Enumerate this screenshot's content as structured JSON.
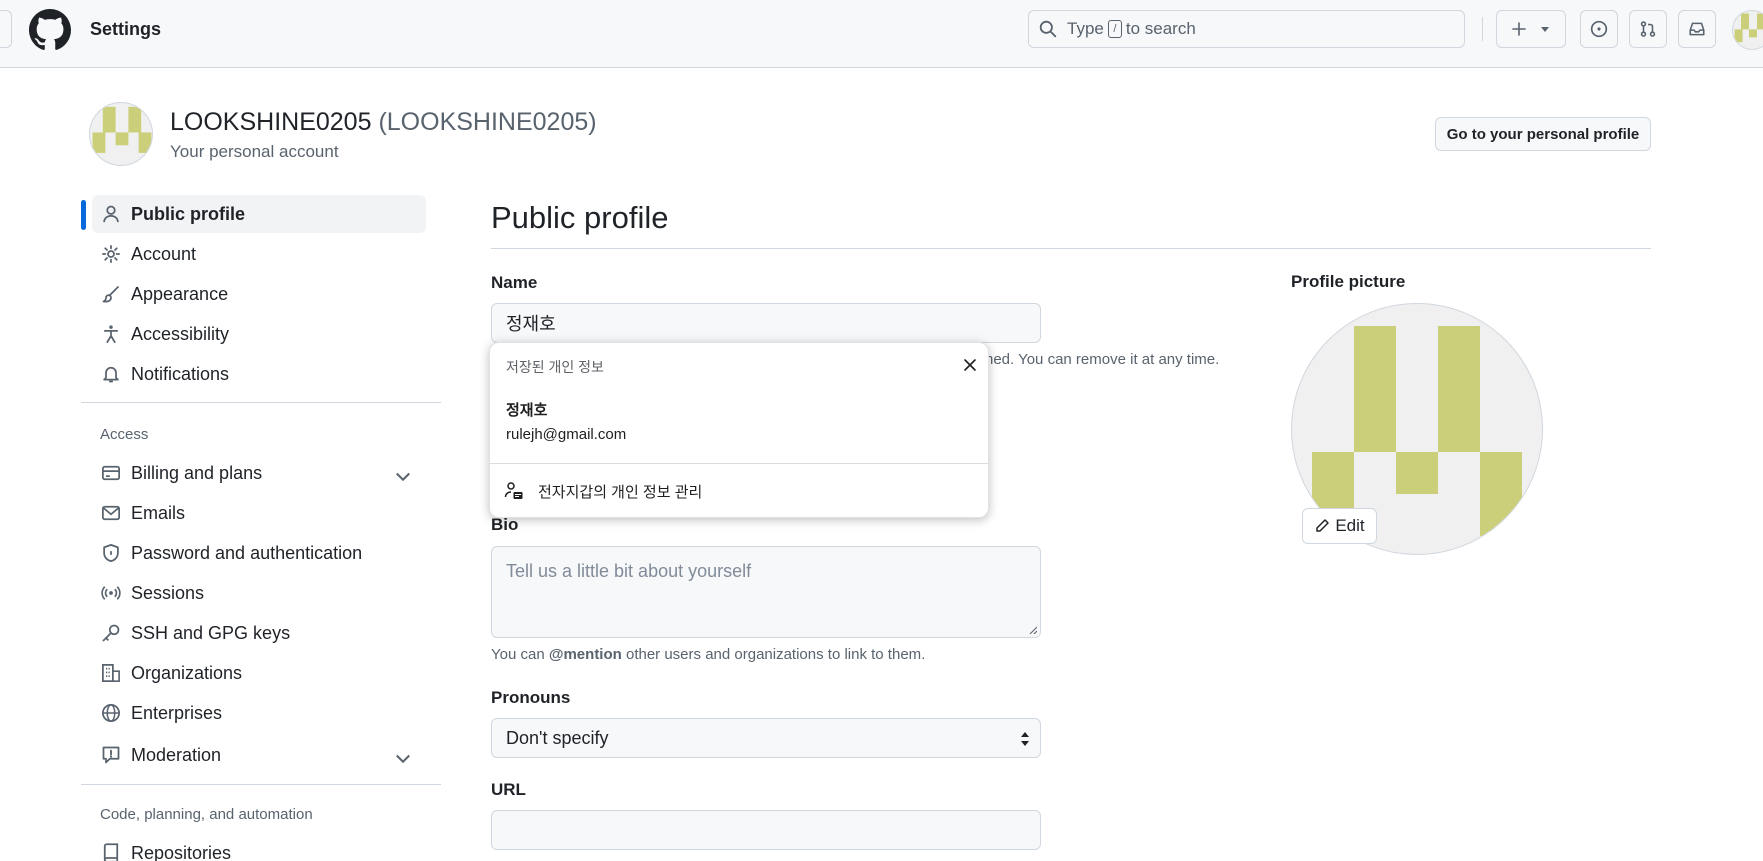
{
  "header": {
    "title": "Settings",
    "search": {
      "prefix": "Type",
      "key": "/",
      "suffix": "to search"
    }
  },
  "account": {
    "name": "LOOKSHINE0205",
    "login": "(LOOKSHINE0205)",
    "subtitle": "Your personal account",
    "profile_button": "Go to your personal profile"
  },
  "sidebar": {
    "items": [
      {
        "label": "Public profile",
        "icon": "person-icon"
      },
      {
        "label": "Account",
        "icon": "gear-icon"
      },
      {
        "label": "Appearance",
        "icon": "paintbrush-icon"
      },
      {
        "label": "Accessibility",
        "icon": "accessibility-icon"
      },
      {
        "label": "Notifications",
        "icon": "bell-icon"
      }
    ],
    "access_heading": "Access",
    "access_items": [
      {
        "label": "Billing and plans",
        "icon": "credit-card-icon"
      },
      {
        "label": "Emails",
        "icon": "mail-icon"
      },
      {
        "label": "Password and authentication",
        "icon": "shield-icon"
      },
      {
        "label": "Sessions",
        "icon": "broadcast-icon"
      },
      {
        "label": "SSH and GPG keys",
        "icon": "key-icon"
      },
      {
        "label": "Organizations",
        "icon": "organization-icon"
      },
      {
        "label": "Enterprises",
        "icon": "globe-icon"
      },
      {
        "label": "Moderation",
        "icon": "report-icon"
      }
    ],
    "code_heading": "Code, planning, and automation",
    "code_items": [
      {
        "label": "Repositories",
        "icon": "repo-icon"
      }
    ]
  },
  "main": {
    "title": "Public profile",
    "name_label": "Name",
    "name_value": "정재호",
    "name_note": "ned. You can remove it at any time.",
    "bio_label": "Bio",
    "bio_placeholder": "Tell us a little bit about yourself",
    "bio_note_prefix": "You can",
    "bio_note_mention": "@mention",
    "bio_note_suffix": "other users and organizations to link to them.",
    "pronouns_label": "Pronouns",
    "pronouns_value": "Don't specify",
    "url_label": "URL",
    "url_value": ""
  },
  "profile_picture": {
    "label": "Profile picture",
    "edit_label": "Edit"
  },
  "autofill": {
    "heading": "저장된 개인 정보",
    "name": "정재호",
    "email": "rulejh@gmail.com",
    "manage": "전자지갑의 개인 정보 관리"
  },
  "colors": {
    "accent": "#0969da",
    "identicon": "#cccf7a"
  }
}
